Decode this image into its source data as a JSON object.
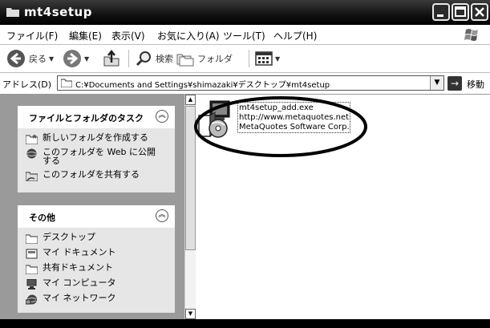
{
  "window": {
    "title": "mt4setup",
    "controls": [
      "minimize",
      "maximize",
      "close"
    ]
  },
  "menu": {
    "items": [
      {
        "label": "ファイル(F)"
      },
      {
        "label": "編集(E)"
      },
      {
        "label": "表示(V)"
      },
      {
        "label": "お気に入り(A)"
      },
      {
        "label": "ツール(T)"
      },
      {
        "label": "ヘルプ(H)"
      }
    ]
  },
  "toolbar": {
    "back_label": "戻る",
    "search_label": "検索",
    "folders_label": "フォルダ"
  },
  "address": {
    "label": "アドレス(D)",
    "value": "C:¥Documents and Settings¥shimazaki¥デスクトップ¥mt4setup",
    "go_label": "移動"
  },
  "tasks_panel": {
    "title": "ファイルとフォルダのタスク",
    "items": [
      {
        "label": "新しいフォルダを作成する",
        "icon": "new-folder-icon"
      },
      {
        "label_line1": "このフォルダを Web に公開",
        "label_line2": "する",
        "icon": "publish-web-icon"
      },
      {
        "label": "このフォルダを共有する",
        "icon": "share-folder-icon"
      }
    ]
  },
  "other_panel": {
    "title": "その他",
    "items": [
      {
        "label": "デスクトップ",
        "icon": "desktop-icon"
      },
      {
        "label": "マイ ドキュメント",
        "icon": "my-documents-icon"
      },
      {
        "label": "共有ドキュメント",
        "icon": "shared-documents-icon"
      },
      {
        "label": "マイ コンピュータ",
        "icon": "my-computer-icon"
      },
      {
        "label": "マイ ネットワーク",
        "icon": "my-network-icon"
      }
    ]
  },
  "file": {
    "name": "mt4setup_add.exe",
    "url": "http://www.metaquotes.net",
    "company": "MetaQuotes Software Corp."
  }
}
